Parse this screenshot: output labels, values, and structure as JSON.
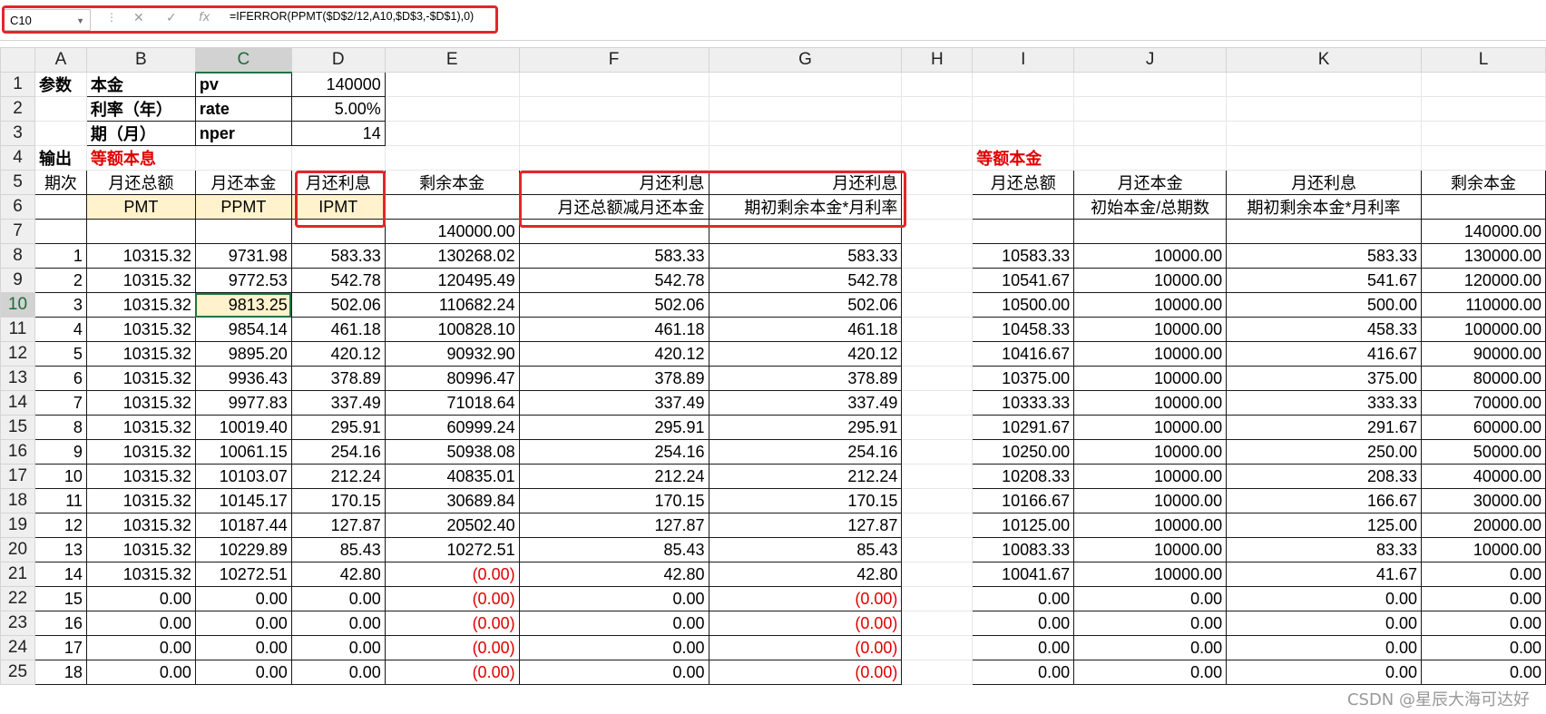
{
  "formula_bar": {
    "name_box": "C10",
    "cancel_icon": "✕",
    "enter_icon": "✓",
    "fx_icon": "fx",
    "formula": "=IFERROR(PPMT($D$2/12,A10,$D$3,-$D$1),0)"
  },
  "columns": [
    "A",
    "B",
    "C",
    "D",
    "E",
    "F",
    "G",
    "H",
    "I",
    "J",
    "K",
    "L"
  ],
  "params": {
    "A1": "参数",
    "B1": "本金",
    "C1": "pv",
    "D1": "140000",
    "B2": "利率（年）",
    "C2": "rate",
    "D2": "5.00%",
    "B3": "期（月）",
    "C3": "nper",
    "D3": "14"
  },
  "output_label": "输出",
  "section_left": "等额本息",
  "section_right": "等额本金",
  "headers": {
    "A5": "期次",
    "B5": "月还总额",
    "C5": "月还本金",
    "D5": "月还利息",
    "E5": "剩余本金",
    "F5": "月还利息",
    "G5": "月还利息",
    "B6": "PMT",
    "C6": "PPMT",
    "D6": "IPMT",
    "F6": "月还总额减月还本金",
    "G6": "期初剩余本金*月利率",
    "I5": "月还总额",
    "J5": "月还本金",
    "K5": "月还利息",
    "L5": "剩余本金",
    "J6": "初始本金/总期数",
    "K6": "期初剩余本金*月利率"
  },
  "row7": {
    "E": "140000.00",
    "L": "140000.00"
  },
  "rows": [
    [
      "1",
      "10315.32",
      "9731.98",
      "583.33",
      "130268.02",
      "583.33",
      "583.33",
      "10583.33",
      "10000.00",
      "583.33",
      "130000.00"
    ],
    [
      "2",
      "10315.32",
      "9772.53",
      "542.78",
      "120495.49",
      "542.78",
      "542.78",
      "10541.67",
      "10000.00",
      "541.67",
      "120000.00"
    ],
    [
      "3",
      "10315.32",
      "9813.25",
      "502.06",
      "110682.24",
      "502.06",
      "502.06",
      "10500.00",
      "10000.00",
      "500.00",
      "110000.00"
    ],
    [
      "4",
      "10315.32",
      "9854.14",
      "461.18",
      "100828.10",
      "461.18",
      "461.18",
      "10458.33",
      "10000.00",
      "458.33",
      "100000.00"
    ],
    [
      "5",
      "10315.32",
      "9895.20",
      "420.12",
      "90932.90",
      "420.12",
      "420.12",
      "10416.67",
      "10000.00",
      "416.67",
      "90000.00"
    ],
    [
      "6",
      "10315.32",
      "9936.43",
      "378.89",
      "80996.47",
      "378.89",
      "378.89",
      "10375.00",
      "10000.00",
      "375.00",
      "80000.00"
    ],
    [
      "7",
      "10315.32",
      "9977.83",
      "337.49",
      "71018.64",
      "337.49",
      "337.49",
      "10333.33",
      "10000.00",
      "333.33",
      "70000.00"
    ],
    [
      "8",
      "10315.32",
      "10019.40",
      "295.91",
      "60999.24",
      "295.91",
      "295.91",
      "10291.67",
      "10000.00",
      "291.67",
      "60000.00"
    ],
    [
      "9",
      "10315.32",
      "10061.15",
      "254.16",
      "50938.08",
      "254.16",
      "254.16",
      "10250.00",
      "10000.00",
      "250.00",
      "50000.00"
    ],
    [
      "10",
      "10315.32",
      "10103.07",
      "212.24",
      "40835.01",
      "212.24",
      "212.24",
      "10208.33",
      "10000.00",
      "208.33",
      "40000.00"
    ],
    [
      "11",
      "10315.32",
      "10145.17",
      "170.15",
      "30689.84",
      "170.15",
      "170.15",
      "10166.67",
      "10000.00",
      "166.67",
      "30000.00"
    ],
    [
      "12",
      "10315.32",
      "10187.44",
      "127.87",
      "20502.40",
      "127.87",
      "127.87",
      "10125.00",
      "10000.00",
      "125.00",
      "20000.00"
    ],
    [
      "13",
      "10315.32",
      "10229.89",
      "85.43",
      "10272.51",
      "85.43",
      "85.43",
      "10083.33",
      "10000.00",
      "83.33",
      "10000.00"
    ],
    [
      "14",
      "10315.32",
      "10272.51",
      "42.80",
      "(0.00)",
      "42.80",
      "42.80",
      "10041.67",
      "10000.00",
      "41.67",
      "0.00"
    ],
    [
      "15",
      "0.00",
      "0.00",
      "0.00",
      "(0.00)",
      "0.00",
      "(0.00)",
      "0.00",
      "0.00",
      "0.00",
      "0.00"
    ],
    [
      "16",
      "0.00",
      "0.00",
      "0.00",
      "(0.00)",
      "0.00",
      "(0.00)",
      "0.00",
      "0.00",
      "0.00",
      "0.00"
    ],
    [
      "17",
      "0.00",
      "0.00",
      "0.00",
      "(0.00)",
      "0.00",
      "(0.00)",
      "0.00",
      "0.00",
      "0.00",
      "0.00"
    ],
    [
      "18",
      "0.00",
      "0.00",
      "0.00",
      "(0.00)",
      "0.00",
      "(0.00)",
      "0.00",
      "0.00",
      "0.00",
      "0.00"
    ]
  ],
  "watermark": "CSDN @星辰大海可达好",
  "colors": {
    "accent_red": "#e3262a",
    "selection_green": "#217346",
    "highlight_yellow": "#fff2cc"
  }
}
